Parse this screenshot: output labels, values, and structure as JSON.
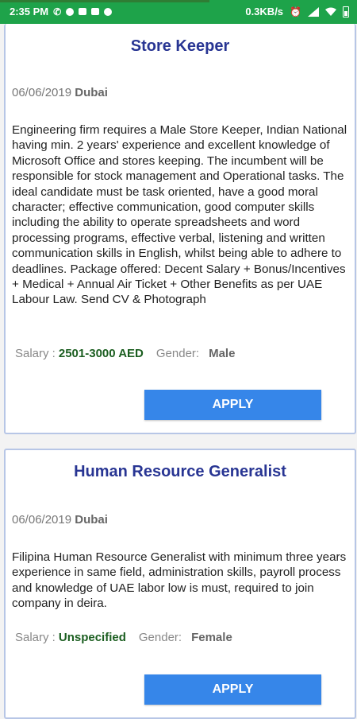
{
  "statusbar": {
    "time": "2:35 PM",
    "speed": "0.3KB/s",
    "icons": [
      "whatsapp-icon",
      "circle-icon",
      "mail-icon",
      "mail-icon",
      "image-icon",
      "alarm-icon",
      "signal-icon",
      "wifi-icon",
      "battery-icon"
    ]
  },
  "jobs": [
    {
      "title": "Store Keeper",
      "date": "06/06/2019",
      "location": "Dubai",
      "description": "Engineering firm requires a Male Store Keeper, Indian National having min. 2 years' experience and excellent knowledge of Microsoft Office and stores keeping. The incumbent will be responsible for stock management and Operational tasks. The ideal candidate must be task oriented, have a good moral character; effective communication, good computer skills including the ability to operate spreadsheets and word processing programs, effective verbal, listening and written communication skills in English, whilst being able to adhere to deadlines. Package offered: Decent Salary + Bonus/Incentives + Medical + Annual Air Ticket + Other Benefits as per UAE Labour Law. Send CV & Photograph",
      "salary_label": "Salary :",
      "salary_value": "2501-3000 AED",
      "gender_label": "Gender:",
      "gender_value": "Male",
      "apply_label": "APPLY"
    },
    {
      "title": "Human Resource Generalist",
      "date": "06/06/2019",
      "location": "Dubai",
      "description": "Filipina Human Resource Generalist with minimum three years experience in same field, administration skills, payroll process and knowledge of UAE labor low is must, required to join company in deira.",
      "salary_label": "Salary :",
      "salary_value": "Unspecified",
      "gender_label": "Gender:",
      "gender_value": "Female",
      "apply_label": "APPLY"
    }
  ],
  "colors": {
    "statusbar": "#1ea34a",
    "title": "#283593",
    "salary": "#1b5e20",
    "button": "#3686e9",
    "card_border": "#b7c6e6"
  }
}
